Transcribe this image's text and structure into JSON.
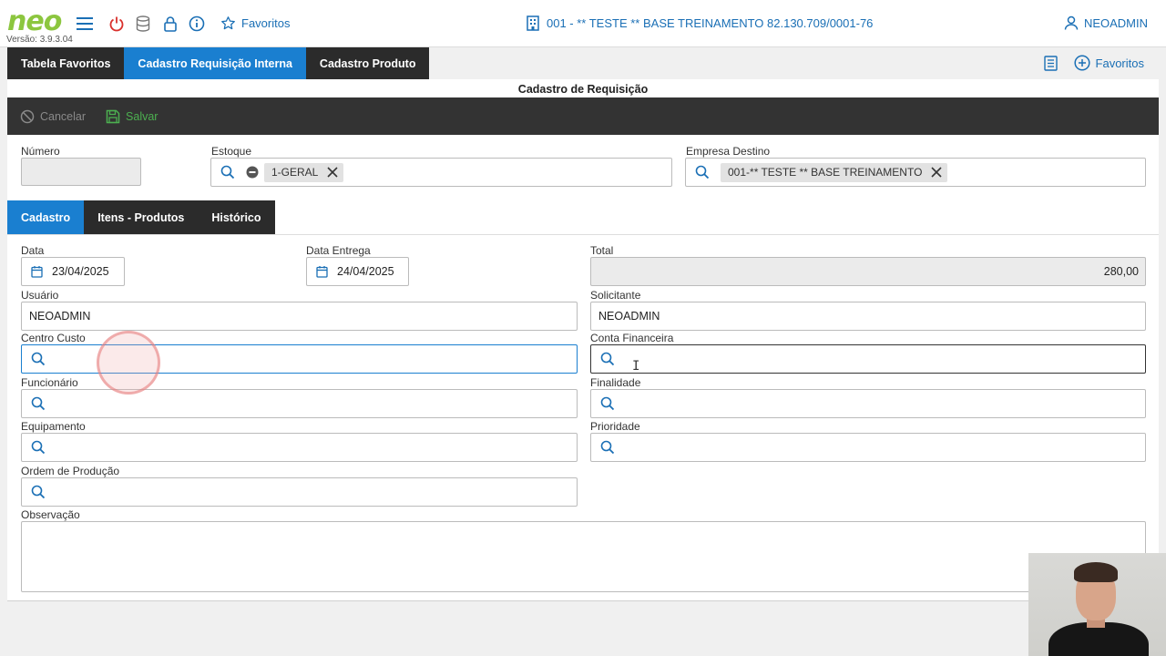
{
  "app": {
    "logo": "neo",
    "version": "Versão: 3.9.3.04",
    "favorites_label": "Favoritos",
    "company": "001 - ** TESTE ** BASE TREINAMENTO 82.130.709/0001-76",
    "user": "NEOADMIN"
  },
  "main_tabs": [
    {
      "label": "Tabela Favoritos",
      "active": false
    },
    {
      "label": "Cadastro Requisição Interna",
      "active": true
    },
    {
      "label": "Cadastro Produto",
      "active": false
    }
  ],
  "tools": {
    "favorites_label": "Favoritos"
  },
  "form": {
    "title": "Cadastro de Requisição",
    "cancel_label": "Cancelar",
    "save_label": "Salvar",
    "numero_label": "Número",
    "numero_value": "",
    "estoque_label": "Estoque",
    "estoque_chip": "1-GERAL",
    "empresa_label": "Empresa Destino",
    "empresa_chip": "001-** TESTE ** BASE TREINAMENTO"
  },
  "sub_tabs": [
    {
      "label": "Cadastro",
      "active": true
    },
    {
      "label": "Itens - Produtos",
      "active": false
    },
    {
      "label": "Histórico",
      "active": false
    }
  ],
  "cadastro": {
    "data_label": "Data",
    "data_value": "23/04/2025",
    "entrega_label": "Data Entrega",
    "entrega_value": "24/04/2025",
    "total_label": "Total",
    "total_value": "280,00",
    "usuario_label": "Usuário",
    "usuario_value": "NEOADMIN",
    "solicitante_label": "Solicitante",
    "solicitante_value": "NEOADMIN",
    "centro_custo_label": "Centro Custo",
    "conta_financeira_label": "Conta Financeira",
    "funcionario_label": "Funcionário",
    "finalidade_label": "Finalidade",
    "equipamento_label": "Equipamento",
    "prioridade_label": "Prioridade",
    "ordem_producao_label": "Ordem de Produção",
    "observacao_label": "Observação"
  },
  "colors": {
    "accent": "#1a7fd0",
    "brand": "#8cc63f",
    "save": "#4caf50",
    "dark": "#2b2b2b"
  }
}
